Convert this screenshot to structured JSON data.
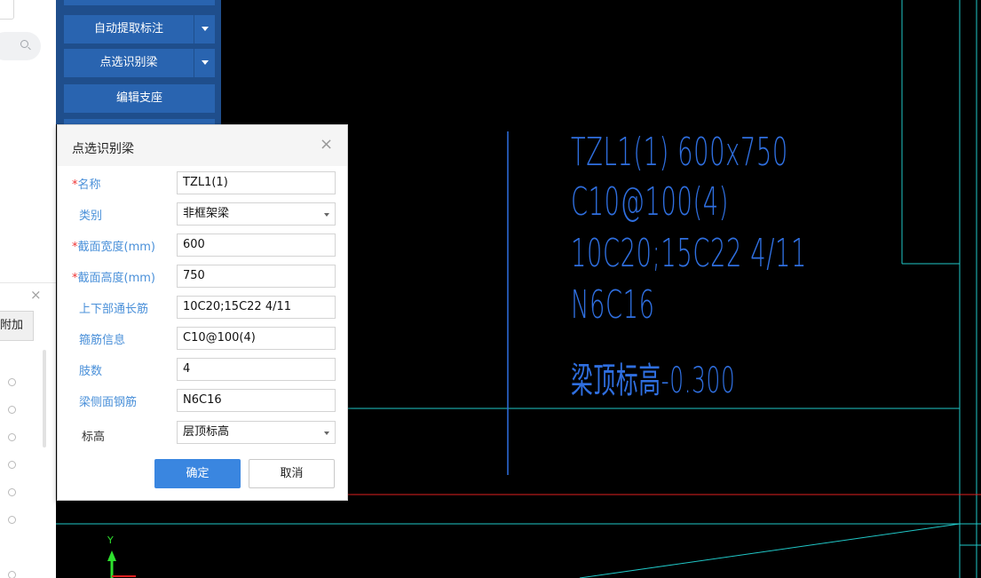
{
  "toolbar": {
    "auto_extract": "自动提取标注",
    "point_identify": "点选识别梁",
    "edit_support": "编辑支座"
  },
  "left_panel": {
    "tab_label": "附加"
  },
  "dialog": {
    "title": "点选识别梁",
    "fields": [
      {
        "label": "名称",
        "required": true,
        "value": "TZL1(1)",
        "type": "input"
      },
      {
        "label": "类别",
        "required": false,
        "value": "非框架梁",
        "type": "select"
      },
      {
        "label": "截面宽度(mm)",
        "required": true,
        "value": "600",
        "type": "input"
      },
      {
        "label": "截面高度(mm)",
        "required": true,
        "value": "750",
        "type": "input"
      },
      {
        "label": "上下部通长筋",
        "required": false,
        "value": "10C20;15C22 4/11",
        "type": "input"
      },
      {
        "label": "箍筋信息",
        "required": false,
        "value": "C10@100(4)",
        "type": "input"
      },
      {
        "label": "肢数",
        "required": false,
        "value": "4",
        "type": "input"
      },
      {
        "label": "梁侧面钢筋",
        "required": false,
        "value": "N6C16",
        "type": "input"
      },
      {
        "label": "标高",
        "required": false,
        "value": "层顶标高",
        "type": "select"
      }
    ],
    "ok_label": "确定",
    "cancel_label": "取消"
  },
  "cad": {
    "annotation_lines": [
      "TZL1(1) 600x750",
      "C10@100(4)",
      "10C20;15C22 4/11",
      "N6C16",
      "梁顶标高-0.300"
    ],
    "axis_y_label": "Y",
    "text_color": "#2f6fe0",
    "line_color": "#20c8c8",
    "red_line_color": "#e02020"
  }
}
